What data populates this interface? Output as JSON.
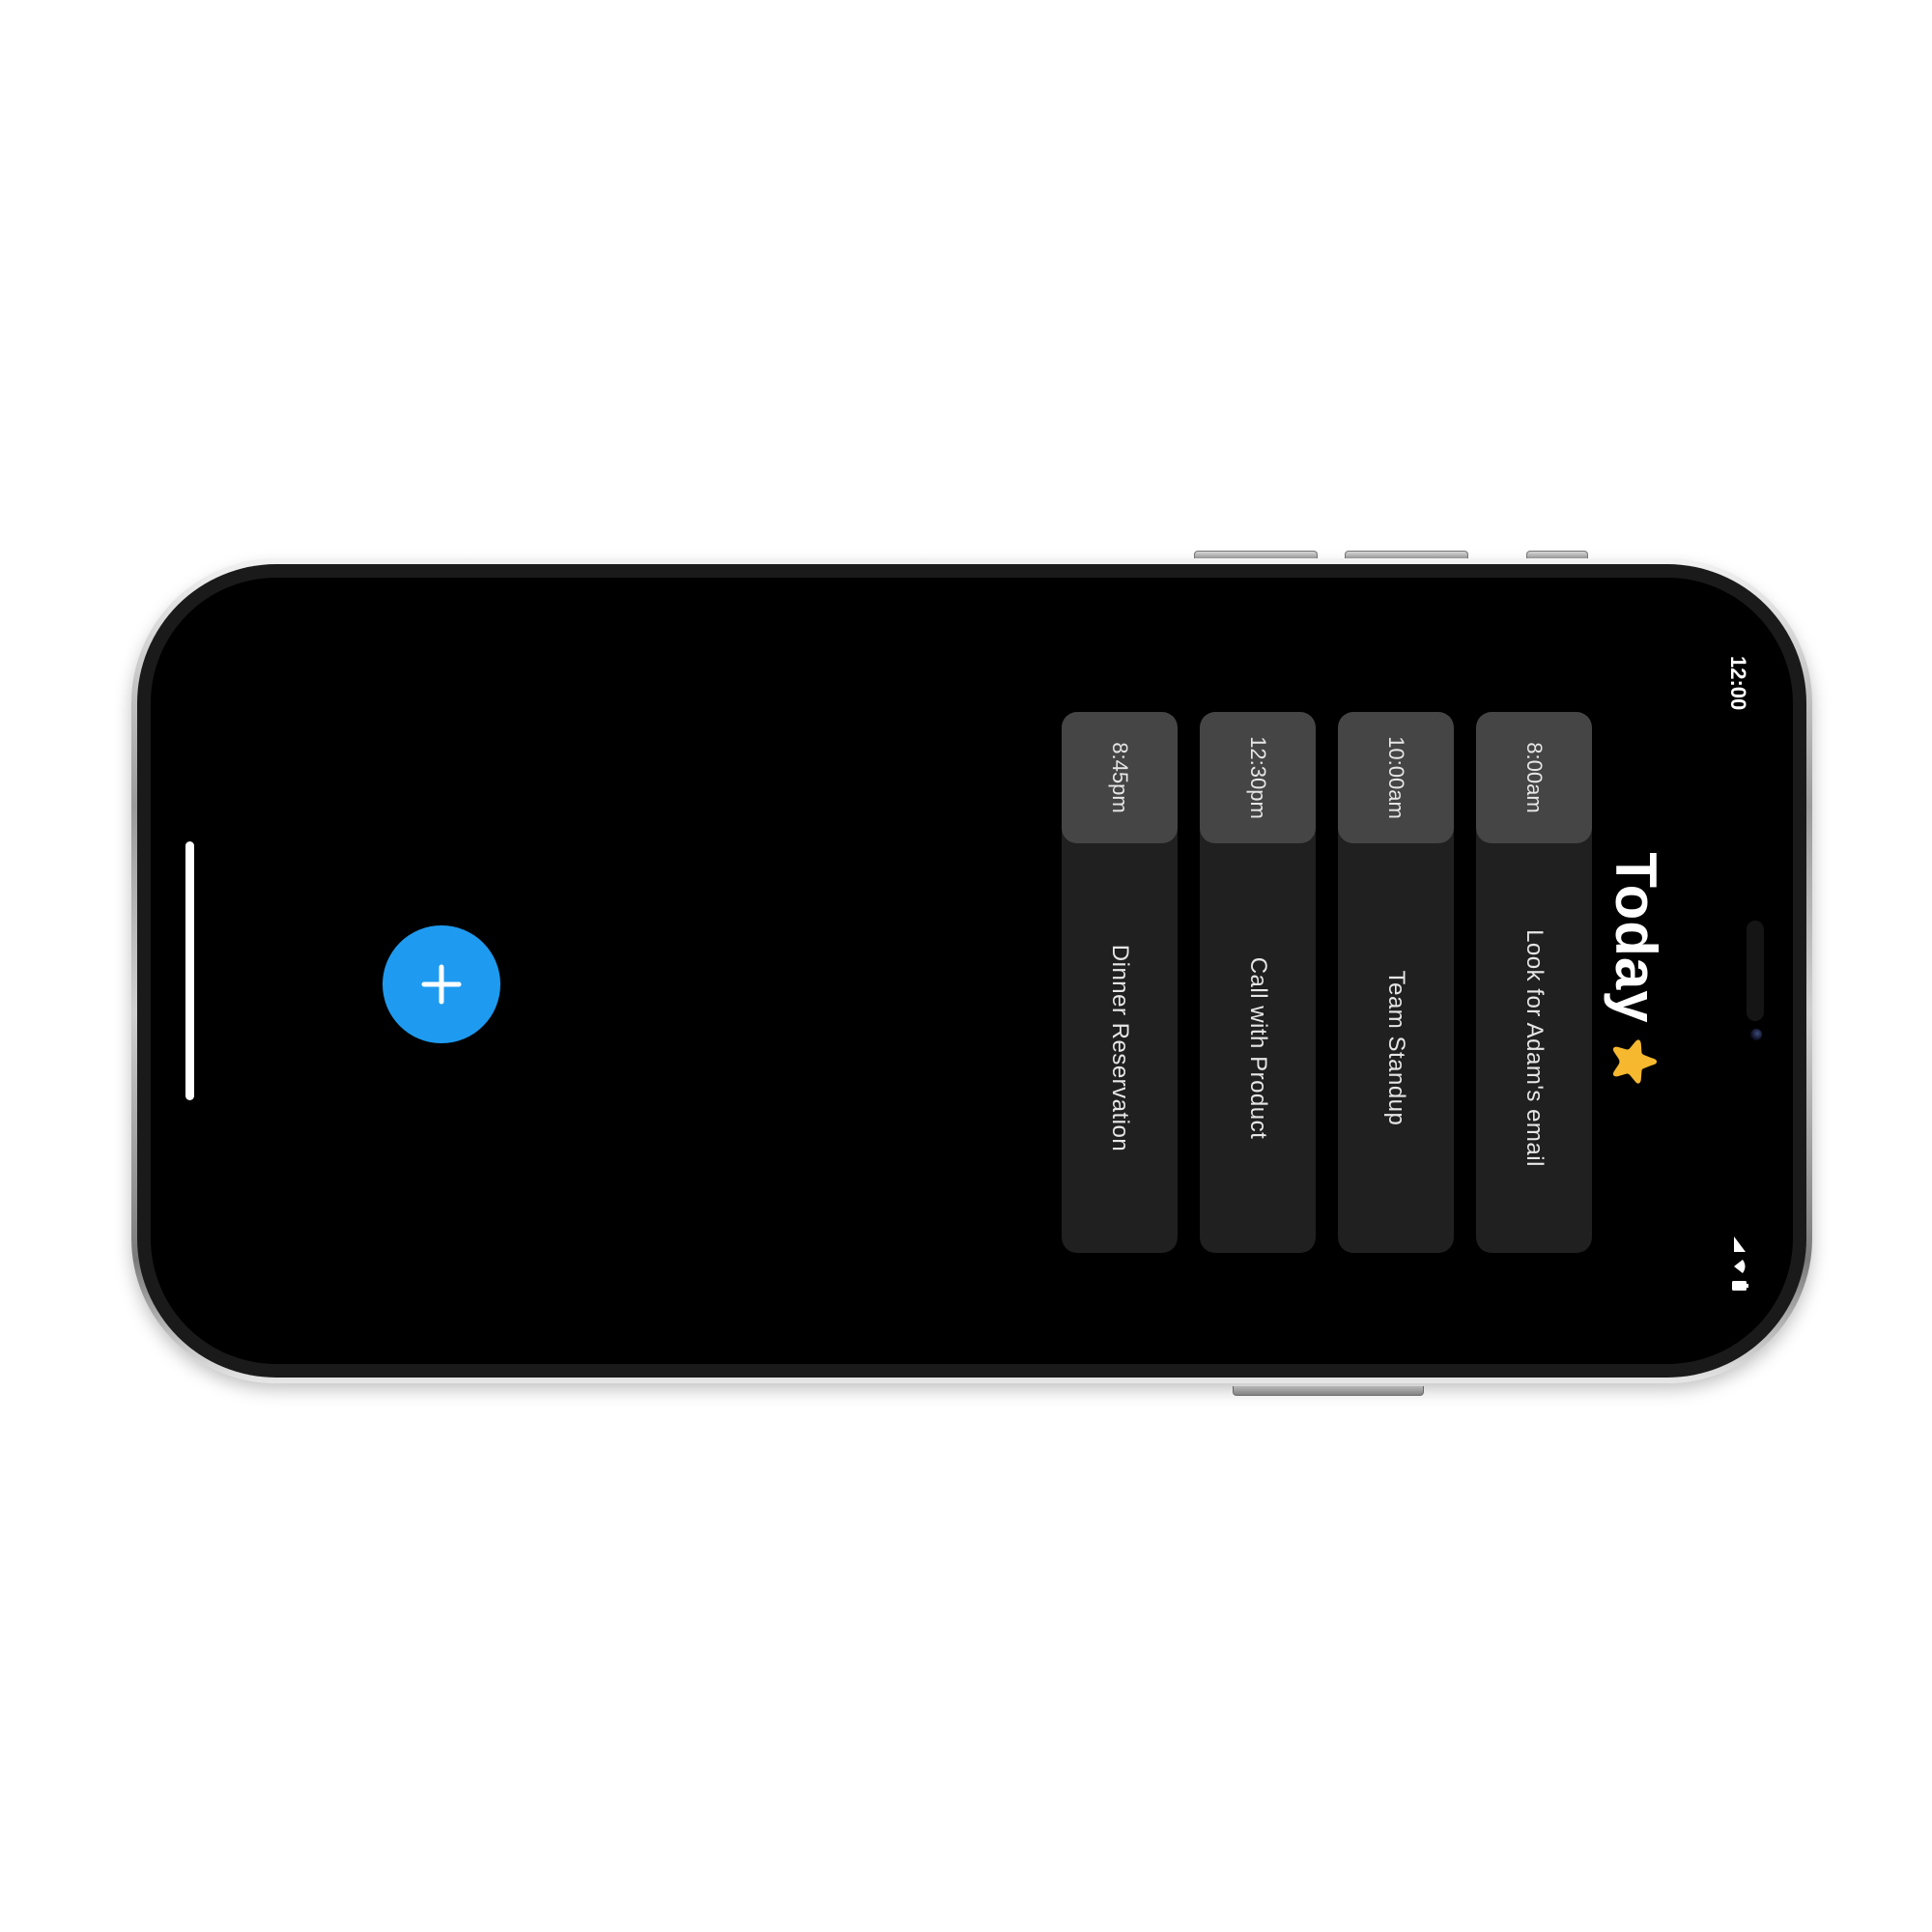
{
  "status_bar": {
    "time": "12:00"
  },
  "header": {
    "title": "Today",
    "icon": "star-icon",
    "icon_color": "#f5b82e"
  },
  "schedule": {
    "items": [
      {
        "time": "8:00am",
        "title": "Look for Adam's email"
      },
      {
        "time": "10:00am",
        "title": "Team Standup"
      },
      {
        "time": "12:30pm",
        "title": "Call with Product"
      },
      {
        "time": "8:45pm",
        "title": "Dinner Reservation"
      }
    ]
  },
  "fab": {
    "icon": "plus-icon",
    "color": "#1e9bf0"
  },
  "colors": {
    "screen_background": "#000000",
    "card_background": "#202020",
    "time_chip_background": "#454545",
    "text": "#e6e6e6"
  }
}
